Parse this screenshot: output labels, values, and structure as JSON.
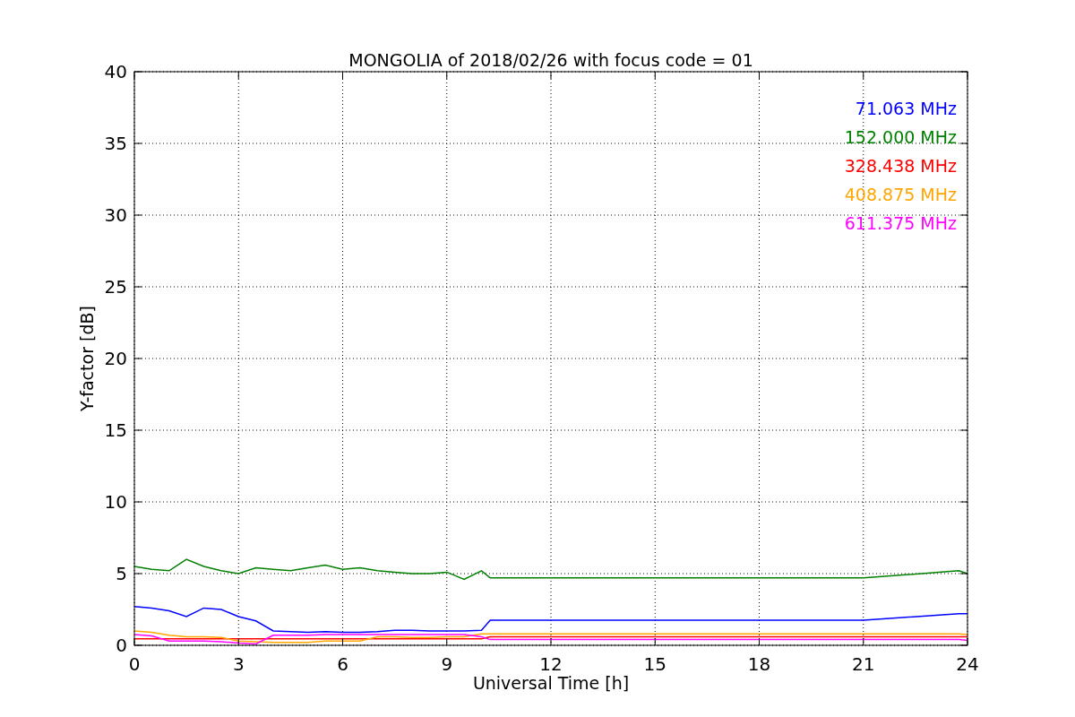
{
  "chart_data": {
    "type": "line",
    "title": "MONGOLIA of 2018/02/26 with focus code = 01",
    "xlabel": "Universal Time [h]",
    "ylabel": "Y-factor [dB]",
    "x": [
      0,
      0.5,
      1,
      1.5,
      2,
      2.5,
      3,
      3.5,
      4,
      4.5,
      5,
      5.5,
      6,
      6.5,
      7,
      7.5,
      8,
      8.5,
      9,
      9.5,
      10,
      10.25,
      12,
      15,
      18,
      21,
      23.75,
      24
    ],
    "series": [
      {
        "name": "71.063 MHz",
        "color": "#0000ff",
        "values": [
          2.7,
          2.6,
          2.4,
          2.0,
          2.6,
          2.5,
          2.0,
          1.7,
          1.0,
          0.95,
          0.9,
          0.95,
          0.9,
          0.9,
          0.95,
          1.05,
          1.05,
          1.0,
          1.0,
          1.0,
          1.05,
          1.75,
          1.75,
          1.75,
          1.75,
          1.75,
          2.2,
          2.2
        ]
      },
      {
        "name": "152.000 MHz",
        "color": "#008000",
        "values": [
          5.5,
          5.3,
          5.2,
          6.0,
          5.5,
          5.2,
          5.0,
          5.4,
          5.3,
          5.2,
          5.4,
          5.6,
          5.3,
          5.4,
          5.2,
          5.1,
          5.0,
          5.0,
          5.1,
          4.6,
          5.2,
          4.7,
          4.7,
          4.7,
          4.7,
          4.7,
          5.2,
          5.0
        ]
      },
      {
        "name": "328.438 MHz",
        "color": "#ff0000",
        "values": [
          0.45,
          0.45,
          0.45,
          0.45,
          0.45,
          0.45,
          0.45,
          0.45,
          0.45,
          0.45,
          0.45,
          0.45,
          0.45,
          0.45,
          0.45,
          0.45,
          0.45,
          0.45,
          0.45,
          0.45,
          0.45,
          0.6,
          0.6,
          0.6,
          0.6,
          0.6,
          0.6,
          0.6
        ]
      },
      {
        "name": "408.875 MHz",
        "color": "#ffa500",
        "values": [
          1.0,
          0.9,
          0.7,
          0.6,
          0.6,
          0.55,
          0.3,
          0.25,
          0.2,
          0.2,
          0.2,
          0.3,
          0.3,
          0.3,
          0.6,
          0.6,
          0.55,
          0.55,
          0.6,
          0.6,
          0.8,
          0.8,
          0.8,
          0.8,
          0.8,
          0.8,
          0.8,
          0.75
        ]
      },
      {
        "name": "611.375 MHz",
        "color": "#ff00ff",
        "values": [
          0.75,
          0.65,
          0.3,
          0.3,
          0.3,
          0.25,
          0.15,
          0.1,
          0.7,
          0.7,
          0.7,
          0.75,
          0.75,
          0.75,
          0.75,
          0.75,
          0.75,
          0.75,
          0.75,
          0.75,
          0.6,
          0.4,
          0.4,
          0.4,
          0.4,
          0.4,
          0.4,
          0.35
        ]
      }
    ],
    "grid": true,
    "xlim": [
      0,
      24
    ],
    "ylim": [
      0,
      40
    ],
    "xticks": [
      0,
      3,
      6,
      9,
      12,
      15,
      18,
      21,
      24
    ],
    "yticks": [
      0,
      5,
      10,
      15,
      20,
      25,
      30,
      35,
      40
    ]
  }
}
